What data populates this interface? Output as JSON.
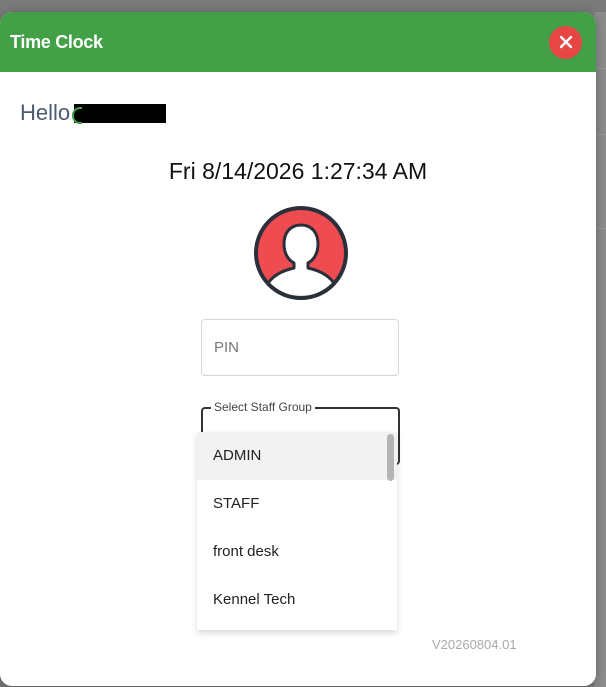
{
  "modal": {
    "title": "Time Clock",
    "close_icon": "close-x-icon"
  },
  "greeting": {
    "prefix": "Hello"
  },
  "clock": {
    "datetime": "Fri 8/14/2026 1:27:34 AM"
  },
  "avatar": {
    "icon": "user-avatar-icon",
    "color": "#ef4c52"
  },
  "pin": {
    "placeholder": "PIN",
    "value": ""
  },
  "staff_group": {
    "label": "Select Staff Group",
    "options": [
      "ADMIN",
      "STAFF",
      "front desk",
      "Kennel Tech"
    ],
    "highlighted": "ADMIN"
  },
  "footer": {
    "version": "V20260804.01"
  },
  "colors": {
    "header": "#43a047",
    "close": "#e84545",
    "greeting_text": "#4d5b70"
  }
}
